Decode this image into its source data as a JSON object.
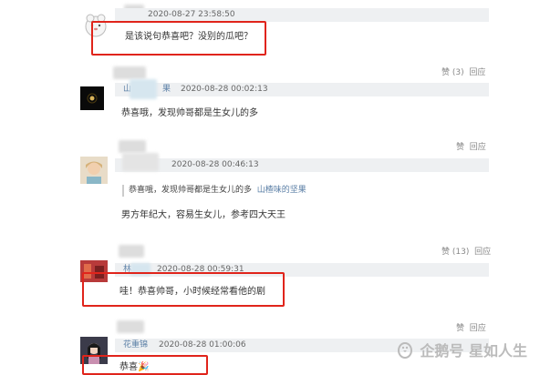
{
  "comments": [
    {
      "time": "2020-08-27 23:58:50",
      "text": "是该说句恭喜吧？没别的瓜吧？",
      "likes": "赞 (3)",
      "reply": "回应"
    },
    {
      "user_partial": "山",
      "user_tail": "果",
      "time": "2020-08-28 00:02:13",
      "text": "恭喜哦，发现帅哥都是生女儿的多",
      "likes": "赞",
      "reply": "回应"
    },
    {
      "time": "2020-08-28 00:46:13",
      "quote_text": "恭喜哦，发现帅哥都是生女儿的多",
      "quote_user": "山楂味的坚果",
      "text": "男方年纪大，容易生女儿，参考四大天王",
      "likes": "赞 (13)",
      "reply": "回应"
    },
    {
      "user_partial": "林",
      "time": "2020-08-28 00:59:31",
      "text": "哇！恭喜帅哥，小时候经常看他的剧",
      "likes": "赞",
      "reply": "回应"
    },
    {
      "user": "花重锦",
      "time": "2020-08-28 01:00:06",
      "text": "恭喜🎉"
    }
  ],
  "watermark": "企鹅号 星如人生",
  "colors": {
    "highlight": "#e0241b",
    "meta_bg": "#eef0f2",
    "link": "#5b7fa6"
  }
}
